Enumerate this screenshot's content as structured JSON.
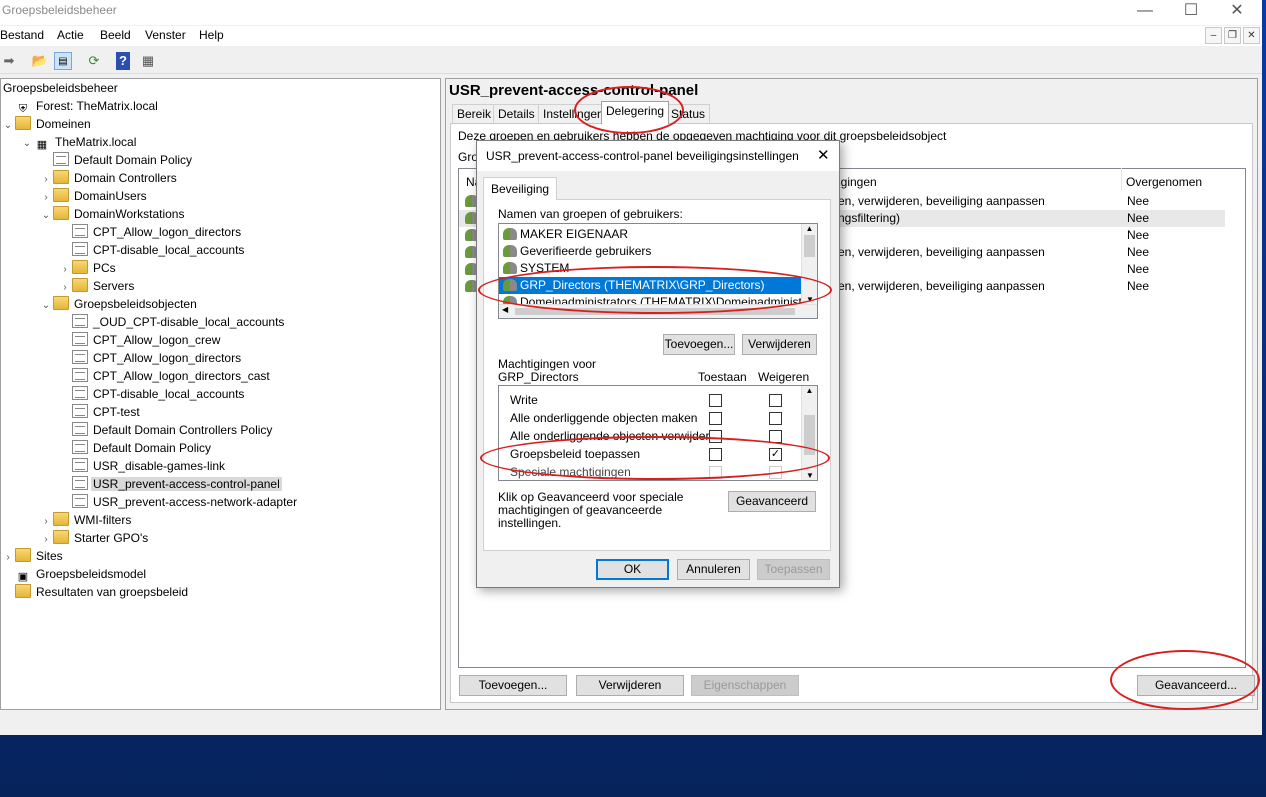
{
  "window": {
    "title": "Groepsbeleidsbeheer",
    "minimize": "—",
    "maximize": "☐",
    "close": "✕"
  },
  "menu": [
    "Bestand",
    "Actie",
    "Beeld",
    "Venster",
    "Help"
  ],
  "mdi": {
    "minimize": "–",
    "restore": "❐",
    "close": "✕"
  },
  "toolbar_icons": [
    "back-arrow-icon",
    "folder-up-icon",
    "show-tree-icon",
    "refresh-icon",
    "help-icon",
    "properties-icon"
  ],
  "tree": [
    {
      "label": "Groepsbeleidsbeheer",
      "level": 0,
      "icon": "none",
      "exp": ""
    },
    {
      "label": "Forest: TheMatrix.local",
      "level": 0,
      "icon": "forest",
      "exp": ""
    },
    {
      "label": "Domeinen",
      "level": 0,
      "icon": "folder",
      "exp": "v"
    },
    {
      "label": "TheMatrix.local",
      "level": 1,
      "icon": "domain",
      "exp": "v"
    },
    {
      "label": "Default Domain Policy",
      "level": 2,
      "icon": "gpo",
      "exp": ""
    },
    {
      "label": "Domain Controllers",
      "level": 2,
      "icon": "folder",
      "exp": ">"
    },
    {
      "label": "DomainUsers",
      "level": 2,
      "icon": "folder",
      "exp": ">"
    },
    {
      "label": "DomainWorkstations",
      "level": 2,
      "icon": "folder",
      "exp": "v"
    },
    {
      "label": "CPT_Allow_logon_directors",
      "level": 3,
      "icon": "gpo",
      "exp": ""
    },
    {
      "label": "CPT-disable_local_accounts",
      "level": 3,
      "icon": "gpo",
      "exp": ""
    },
    {
      "label": "PCs",
      "level": 3,
      "icon": "folder",
      "exp": ">"
    },
    {
      "label": "Servers",
      "level": 3,
      "icon": "folder",
      "exp": ">"
    },
    {
      "label": "Groepsbeleidsobjecten",
      "level": 2,
      "icon": "folder",
      "exp": "v"
    },
    {
      "label": "_OUD_CPT-disable_local_accounts",
      "level": 3,
      "icon": "gpo",
      "exp": ""
    },
    {
      "label": "CPT_Allow_logon_crew",
      "level": 3,
      "icon": "gpo",
      "exp": ""
    },
    {
      "label": "CPT_Allow_logon_directors",
      "level": 3,
      "icon": "gpo",
      "exp": ""
    },
    {
      "label": "CPT_Allow_logon_directors_cast",
      "level": 3,
      "icon": "gpo",
      "exp": ""
    },
    {
      "label": "CPT-disable_local_accounts",
      "level": 3,
      "icon": "gpo",
      "exp": ""
    },
    {
      "label": "CPT-test",
      "level": 3,
      "icon": "gpo",
      "exp": ""
    },
    {
      "label": "Default Domain Controllers Policy",
      "level": 3,
      "icon": "gpo",
      "exp": ""
    },
    {
      "label": "Default Domain Policy",
      "level": 3,
      "icon": "gpo",
      "exp": ""
    },
    {
      "label": "USR_disable-games-link",
      "level": 3,
      "icon": "gpo",
      "exp": ""
    },
    {
      "label": "USR_prevent-access-control-panel",
      "level": 3,
      "icon": "gpo",
      "exp": "",
      "selected": true
    },
    {
      "label": "USR_prevent-access-network-adapter",
      "level": 3,
      "icon": "gpo",
      "exp": ""
    },
    {
      "label": "WMI-filters",
      "level": 2,
      "icon": "folder",
      "exp": ">"
    },
    {
      "label": "Starter GPO's",
      "level": 2,
      "icon": "folder",
      "exp": ">"
    },
    {
      "label": "Sites",
      "level": 0,
      "icon": "folder",
      "exp": ">"
    },
    {
      "label": "Groepsbeleidsmodel",
      "level": 0,
      "icon": "model",
      "exp": ""
    },
    {
      "label": "Resultaten van groepsbeleid",
      "level": 0,
      "icon": "folder",
      "exp": ""
    }
  ],
  "right": {
    "title": "USR_prevent-access-control-panel",
    "tabs": [
      "Bereik",
      "Details",
      "Instellingen",
      "Delegering",
      "Status"
    ],
    "active_tab": "Delegering",
    "desc": "Deze groepen en gebruikers hebben de opgegeven machtiging voor dit groepsbeleidsobject",
    "groups_label": "Groe",
    "col_name": "Na",
    "col_perm": "igingen",
    "col_inherited": "Overgenomen",
    "rows": [
      {
        "perm": "en, verwijderen, beveiliging aanpassen",
        "inh": "Nee"
      },
      {
        "perm": "ngsfiltering)",
        "inh": "Nee"
      },
      {
        "perm": "",
        "inh": "Nee"
      },
      {
        "perm": "en, verwijderen, beveiliging aanpassen",
        "inh": "Nee"
      },
      {
        "perm": "",
        "inh": "Nee"
      },
      {
        "perm": "en, verwijderen, beveiliging aanpassen",
        "inh": "Nee"
      }
    ],
    "buttons": {
      "add": "Toevoegen...",
      "remove": "Verwijderen",
      "props": "Eigenschappen",
      "advanced": "Geavanceerd..."
    }
  },
  "dialog": {
    "title": "USR_prevent-access-control-panel beveiligingsinstellingen",
    "close": "✕",
    "tab": "Beveiliging",
    "users_label": "Namen van groepen of gebruikers:",
    "users": [
      "MAKER EIGENAAR",
      "Geverifieerde gebruikers",
      "SYSTEM",
      "GRP_Directors (THEMATRIX\\GRP_Directors)",
      "Domeinadministrators (THEMATRIX\\Domeinadministrators)"
    ],
    "selected_user": "GRP_Directors (THEMATRIX\\GRP_Directors)",
    "btn_add": "Toevoegen...",
    "btn_remove": "Verwijderen",
    "perm_label_1": "Machtigingen voor",
    "perm_label_2": "GRP_Directors",
    "col_allow": "Toestaan",
    "col_deny": "Weigeren",
    "perms": [
      {
        "name": "Write",
        "allow": false,
        "deny": false
      },
      {
        "name": "Alle onderliggende objecten maken",
        "allow": false,
        "deny": false
      },
      {
        "name": "Alle onderliggende objecten verwijderen",
        "allow": false,
        "deny": false
      },
      {
        "name": "Groepsbeleid toepassen",
        "allow": false,
        "deny": true
      },
      {
        "name": "Speciale machtigingen",
        "allow": false,
        "deny": false,
        "disabled": true
      }
    ],
    "adv_text": "Klik op Geavanceerd voor speciale machtigingen of geavanceerde instellingen.",
    "btn_advanced": "Geavanceerd",
    "btn_ok": "OK",
    "btn_cancel": "Annuleren",
    "btn_apply": "Toepassen",
    "check_mark": "✓"
  },
  "colors": {
    "selection": "#0078d7",
    "annotation": "#d81e1e",
    "taskbar": "#0c2e80"
  }
}
